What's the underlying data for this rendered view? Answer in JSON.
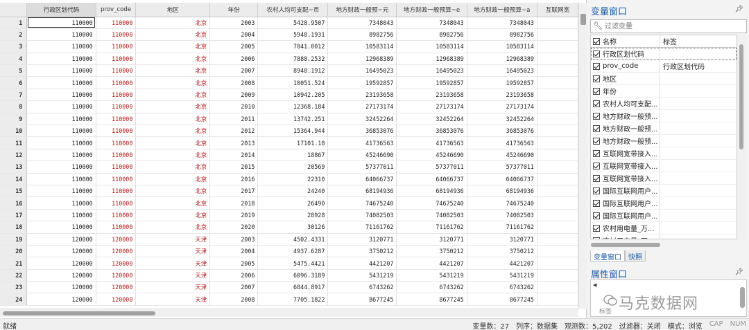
{
  "grid": {
    "columns": [
      "行政区划代码",
      "prov_code",
      "地区",
      "年份",
      "农村人均可支配~币",
      "地方财政一般预~元",
      "地方财政一般预算~e",
      "地方财政一般预算~a",
      "互联网宽"
    ],
    "rows": [
      [
        "1",
        "110000",
        "110000",
        "北京",
        "2003",
        "5428.9507",
        "7348043",
        "7348043",
        "7348043"
      ],
      [
        "2",
        "110000",
        "110000",
        "北京",
        "2004",
        "5948.1931",
        "8982756",
        "8982756",
        "8982756"
      ],
      [
        "3",
        "110000",
        "110000",
        "北京",
        "2005",
        "7041.0012",
        "10583114",
        "10583114",
        "10583114"
      ],
      [
        "4",
        "110000",
        "110000",
        "北京",
        "2006",
        "7888.2532",
        "12968389",
        "12968389",
        "12968389"
      ],
      [
        "5",
        "110000",
        "110000",
        "北京",
        "2007",
        "8948.1912",
        "16495023",
        "16495023",
        "16495023"
      ],
      [
        "6",
        "110000",
        "110000",
        "北京",
        "2008",
        "10051.524",
        "19592857",
        "19592857",
        "19592857"
      ],
      [
        "7",
        "110000",
        "110000",
        "北京",
        "2009",
        "10942.205",
        "23193658",
        "23193658",
        "23193658"
      ],
      [
        "8",
        "110000",
        "110000",
        "北京",
        "2010",
        "12368.184",
        "27173174",
        "27173174",
        "27173174"
      ],
      [
        "9",
        "110000",
        "110000",
        "北京",
        "2011",
        "13742.251",
        "32452264",
        "32452264",
        "32452264"
      ],
      [
        "10",
        "110000",
        "110000",
        "北京",
        "2012",
        "15364.944",
        "36853076",
        "36853076",
        "36853076"
      ],
      [
        "11",
        "110000",
        "110000",
        "北京",
        "2013",
        "17101.18",
        "41736563",
        "41736563",
        "41736563"
      ],
      [
        "12",
        "110000",
        "110000",
        "北京",
        "2014",
        "18867",
        "45246690",
        "45246690",
        "45246690"
      ],
      [
        "13",
        "110000",
        "110000",
        "北京",
        "2015",
        "20569",
        "57377011",
        "57377011",
        "57377011"
      ],
      [
        "14",
        "110000",
        "110000",
        "北京",
        "2016",
        "22310",
        "64066737",
        "64066737",
        "64066737"
      ],
      [
        "15",
        "110000",
        "110000",
        "北京",
        "2017",
        "24240",
        "68194936",
        "68194936",
        "68194936"
      ],
      [
        "16",
        "110000",
        "110000",
        "北京",
        "2018",
        "26490",
        "74675240",
        "74675240",
        "74675240"
      ],
      [
        "17",
        "110000",
        "110000",
        "北京",
        "2019",
        "28928",
        "74082503",
        "74082503",
        "74082503"
      ],
      [
        "18",
        "110000",
        "110000",
        "北京",
        "2020",
        "30126",
        "71161762",
        "71161762",
        "71161762"
      ],
      [
        "19",
        "120000",
        "120000",
        "天津",
        "2003",
        "4502.4331",
        "3120771",
        "3120771",
        "3120771"
      ],
      [
        "20",
        "120000",
        "120000",
        "天津",
        "2004",
        "4937.6287",
        "3750212",
        "3750212",
        "3750212"
      ],
      [
        "21",
        "120000",
        "120000",
        "天津",
        "2005",
        "5475.4421",
        "4421207",
        "4421207",
        "4421207"
      ],
      [
        "22",
        "120000",
        "120000",
        "天津",
        "2006",
        "6096.3189",
        "5431219",
        "5431219",
        "5431219"
      ],
      [
        "23",
        "120000",
        "120000",
        "天津",
        "2007",
        "6844.8917",
        "6743262",
        "6743262",
        "6743262"
      ],
      [
        "24",
        "120000",
        "120000",
        "天津",
        "2008",
        "7705.1822",
        "8677245",
        "8677245",
        "8677245"
      ]
    ]
  },
  "variables_panel": {
    "title": "变量窗口",
    "filter_placeholder": "过滤变量",
    "col_name": "名称",
    "col_label": "标签",
    "items": [
      {
        "name": "行政区划代码",
        "label": ""
      },
      {
        "name": "prov_code",
        "label": "行政区划代码"
      },
      {
        "name": "地区",
        "label": ""
      },
      {
        "name": "年份",
        "label": ""
      },
      {
        "name": "农村人均可支配...",
        "label": ""
      },
      {
        "name": "地方财政一般预...",
        "label": ""
      },
      {
        "name": "地方财政一般预...",
        "label": ""
      },
      {
        "name": "地方财政一般预...",
        "label": ""
      },
      {
        "name": "互联网宽带接入...",
        "label": ""
      },
      {
        "name": "互联网宽带接入...",
        "label": ""
      },
      {
        "name": "互联网宽带接入...",
        "label": ""
      },
      {
        "name": "国际互联网用户...",
        "label": ""
      },
      {
        "name": "国际互联网用户...",
        "label": ""
      },
      {
        "name": "国际互联网用户...",
        "label": ""
      },
      {
        "name": "农村用电量_万...",
        "label": ""
      },
      {
        "name": "农村用电量_万...",
        "label": ""
      }
    ]
  },
  "tabs": {
    "variables": "变量窗口",
    "snapshots": "快照"
  },
  "properties_panel": {
    "title": "属性窗口",
    "field_label": "标签",
    "watermark": "马克数据网"
  },
  "status_bar": {
    "ready": "就绪",
    "var_count": "变量数：27",
    "sort": "列序：数据集",
    "obs_count": "观测数：5,202",
    "filter": "过滤器：关闭",
    "mode": "模式：浏览",
    "cap": "CAP",
    "num": "NUM"
  },
  "colors": {
    "string_red": "#b21a1a",
    "title_blue": "#1a5aa6"
  }
}
